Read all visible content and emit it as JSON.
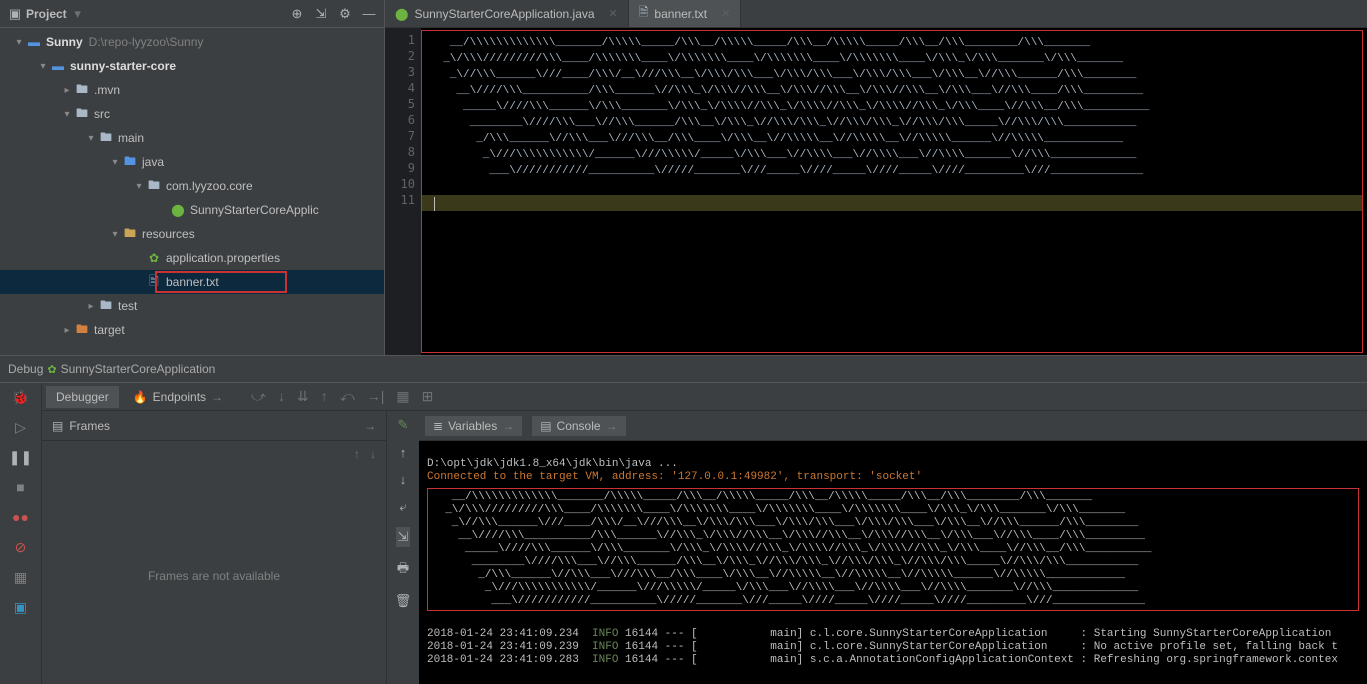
{
  "project": {
    "title": "Project",
    "tree": {
      "root": {
        "name": "Sunny",
        "path": "D:\\repo-lyyzoo\\Sunny"
      },
      "core": "sunny-starter-core",
      "mvn": ".mvn",
      "src": "src",
      "main": "main",
      "java": "java",
      "pkg": "com.lyyzoo.core",
      "app_class": "SunnyStarterCoreApplic",
      "resources": "resources",
      "app_props": "application.properties",
      "banner": "banner.txt",
      "test": "test",
      "target": "target"
    }
  },
  "tabs": {
    "tab1": "SunnyStarterCoreApplication.java",
    "tab2": "banner.txt"
  },
  "editor": {
    "lines": [
      "1",
      "2",
      "3",
      "4",
      "5",
      "6",
      "7",
      "8",
      "9",
      "10",
      "11"
    ],
    "ascii": "   __/\\\\\\\\\\\\\\\\\\\\\\\\\\_______/\\\\\\\\\\_____/\\\\\\__/\\\\\\\\\\_____/\\\\\\__/\\\\\\\\\\_____/\\\\\\__/\\\\\\________/\\\\\\_______\n  _\\/\\\\\\/////////\\\\\\____/\\\\\\\\\\\\\\____\\/\\\\\\\\\\\\\\____\\/\\\\\\\\\\\\\\____\\/\\\\\\\\\\\\\\____\\/\\\\\\_\\/\\\\\\_______\\/\\\\\\_______\n   _\\//\\\\\\______\\///____/\\\\\\/__\\///\\\\\\__\\/\\\\\\/\\\\\\___\\/\\\\\\/\\\\\\___\\/\\\\\\/\\\\\\___\\/\\\\\\__\\//\\\\\\______/\\\\\\________\n    __\\////\\\\\\__________/\\\\\\______\\//\\\\\\_\\/\\\\\\//\\\\\\__\\/\\\\\\//\\\\\\__\\/\\\\\\//\\\\\\__\\/\\\\\\___\\//\\\\\\____/\\\\\\_________\n     _____\\////\\\\\\______\\/\\\\\\_______\\/\\\\\\_\\/\\\\\\\\//\\\\\\_\\/\\\\\\\\//\\\\\\_\\/\\\\\\\\//\\\\\\_\\/\\\\\\____\\//\\\\\\__/\\\\\\__________\n      ________\\////\\\\\\___\\//\\\\\\______/\\\\\\__\\/\\\\\\_\\//\\\\\\/\\\\\\_\\//\\\\\\/\\\\\\_\\//\\\\\\/\\\\\\_____\\//\\\\\\/\\\\\\___________\n       _/\\\\\\______\\//\\\\\\___\\///\\\\\\__/\\\\\\____\\/\\\\\\__\\//\\\\\\\\\\__\\//\\\\\\\\\\__\\//\\\\\\\\\\______\\//\\\\\\\\\\____________\n        _\\///\\\\\\\\\\\\\\\\\\\\\\/______\\///\\\\\\\\\\/_____\\/\\\\\\___\\//\\\\\\\\___\\//\\\\\\\\___\\//\\\\\\\\_______\\//\\\\\\_____________\n         ___\\///////////__________\\/////_______\\///_____\\////_____\\////_____\\////_________\\///______________"
  },
  "debug": {
    "label": "Debug",
    "config": "SunnyStarterCoreApplication",
    "debugger_tab": "Debugger",
    "endpoints_tab": "Endpoints",
    "variables_tab": "Variables",
    "console_tab": "Console",
    "frames_title": "Frames",
    "frames_empty": "Frames are not available"
  },
  "console": {
    "cmd": "D:\\opt\\jdk\\jdk1.8_x64\\jdk\\bin\\java ...",
    "connected": "Connected to the target VM, address: '127.0.0.1:49982', transport: 'socket'",
    "ascii": "   __/\\\\\\\\\\\\\\\\\\\\\\\\\\_______/\\\\\\\\\\_____/\\\\\\__/\\\\\\\\\\_____/\\\\\\__/\\\\\\\\\\_____/\\\\\\__/\\\\\\________/\\\\\\_______\n  _\\/\\\\\\/////////\\\\\\____/\\\\\\\\\\\\\\____\\/\\\\\\\\\\\\\\____\\/\\\\\\\\\\\\\\____\\/\\\\\\\\\\\\\\____\\/\\\\\\_\\/\\\\\\_______\\/\\\\\\_______\n   _\\//\\\\\\______\\///____/\\\\\\/__\\///\\\\\\__\\/\\\\\\/\\\\\\___\\/\\\\\\/\\\\\\___\\/\\\\\\/\\\\\\___\\/\\\\\\__\\//\\\\\\______/\\\\\\________\n    __\\////\\\\\\__________/\\\\\\______\\//\\\\\\_\\/\\\\\\//\\\\\\__\\/\\\\\\//\\\\\\__\\/\\\\\\//\\\\\\__\\/\\\\\\___\\//\\\\\\____/\\\\\\_________\n     _____\\////\\\\\\______\\/\\\\\\_______\\/\\\\\\_\\/\\\\\\\\//\\\\\\_\\/\\\\\\\\//\\\\\\_\\/\\\\\\\\//\\\\\\_\\/\\\\\\____\\//\\\\\\__/\\\\\\__________\n      ________\\////\\\\\\___\\//\\\\\\______/\\\\\\__\\/\\\\\\_\\//\\\\\\/\\\\\\_\\//\\\\\\/\\\\\\_\\//\\\\\\/\\\\\\_____\\//\\\\\\/\\\\\\___________\n       _/\\\\\\______\\//\\\\\\___\\///\\\\\\__/\\\\\\____\\/\\\\\\__\\//\\\\\\\\\\__\\//\\\\\\\\\\__\\//\\\\\\\\\\______\\//\\\\\\\\\\____________\n        _\\///\\\\\\\\\\\\\\\\\\\\\\/______\\///\\\\\\\\\\/_____\\/\\\\\\___\\//\\\\\\\\___\\//\\\\\\\\___\\//\\\\\\\\_______\\//\\\\\\_____________\n         ___\\///////////__________\\/////_______\\///_____\\////_____\\////_____\\////_________\\///______________",
    "log1": "2018-01-24 23:41:09.234  INFO 16144 --- [           main] c.l.core.SunnyStarterCoreApplication     : Starting SunnyStarterCoreApplication",
    "log2": "2018-01-24 23:41:09.239  INFO 16144 --- [           main] c.l.core.SunnyStarterCoreApplication     : No active profile set, falling back t",
    "log3": "2018-01-24 23:41:09.283  INFO 16144 --- [           main] s.c.a.AnnotationConfigApplicationContext : Refreshing org.springframework.contex"
  }
}
